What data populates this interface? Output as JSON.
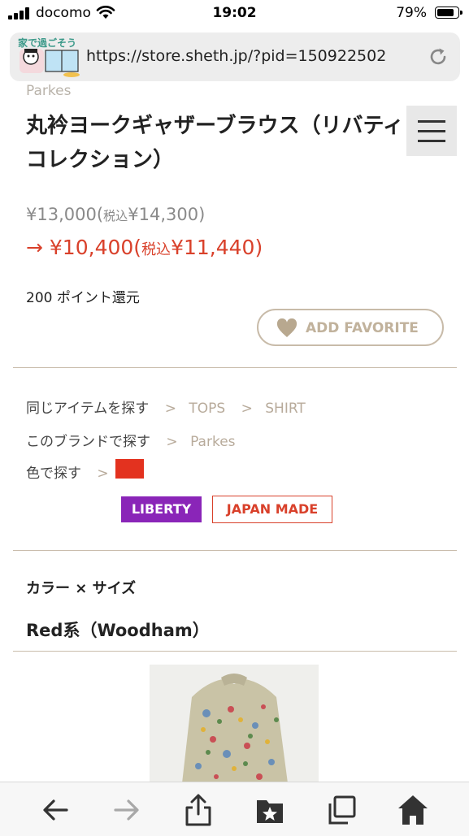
{
  "status_bar": {
    "carrier": "docomo",
    "time": "19:02",
    "battery": "79%"
  },
  "browser": {
    "url": "https://store.sheth.jp/?pid=150922502",
    "thumbnail_text": "家で過ごそう"
  },
  "product": {
    "brand_peek": "Parkes",
    "title": "丸衿ヨークギャザーブラウス（リバティコレクション）",
    "price_original": {
      "price": "¥13,000",
      "tax_prefix": "(",
      "tax_label": "税込",
      "tax_price": "¥14,300)"
    },
    "price_sale": {
      "arrow": "→ ",
      "price": "¥10,400",
      "tax_prefix": "(",
      "tax_label": "税込",
      "tax_price": "¥11,440)"
    },
    "points": "200 ポイント還元",
    "favorite_button": "ADD FAVORITE"
  },
  "search_links": {
    "same_item": {
      "label": "同じアイテムを探す",
      "sep": ">",
      "links": [
        "TOPS",
        "SHIRT"
      ]
    },
    "brand": {
      "label": "このブランドで探す",
      "sep": ">",
      "link": "Parkes"
    },
    "color": {
      "label": "色で探す",
      "sep": ">",
      "swatch_color": "#e3321f"
    }
  },
  "tags": [
    "LIBERTY",
    "JAPAN MADE"
  ],
  "variants": {
    "heading": "カラー × サイズ",
    "name": "Red系（Woodham）"
  },
  "toolbar": [
    "back-arrow-icon",
    "forward-arrow-icon",
    "share-icon",
    "bookmarks-icon",
    "tabs-icon",
    "home-icon"
  ]
}
